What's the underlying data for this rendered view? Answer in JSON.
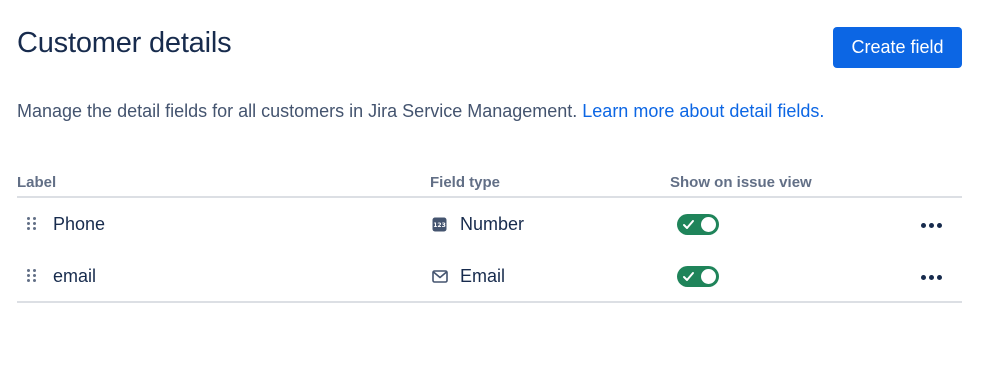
{
  "header": {
    "title": "Customer details",
    "create_button_label": "Create field"
  },
  "description": {
    "text": "Manage the detail fields for all customers in Jira Service Management. ",
    "link_text": "Learn more about detail fields."
  },
  "table": {
    "columns": [
      "Label",
      "Field type",
      "Show on issue view"
    ],
    "rows": [
      {
        "label": "Phone",
        "field_type": "Number",
        "type_icon": "number-icon",
        "show_on_issue_view": true
      },
      {
        "label": "email",
        "field_type": "Email",
        "type_icon": "email-icon",
        "show_on_issue_view": true
      }
    ]
  },
  "colors": {
    "primary": "#0c66e4",
    "toggle_on": "#1f845a",
    "text": "#172b4d",
    "subtle_text": "#626f86"
  }
}
